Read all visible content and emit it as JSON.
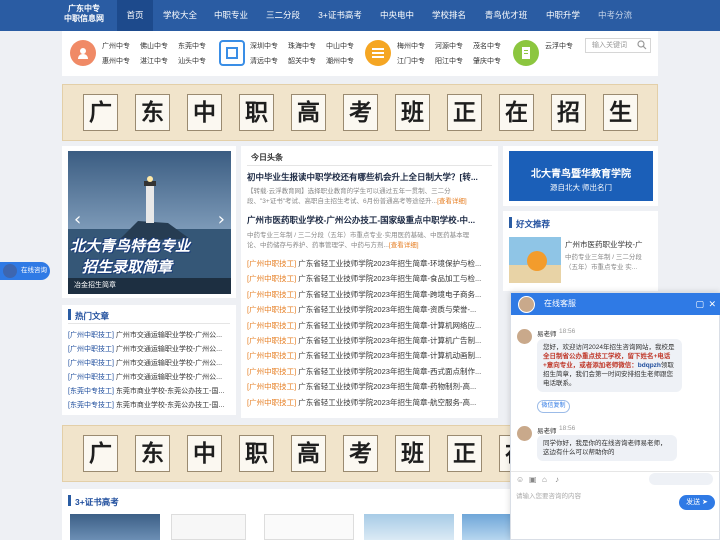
{
  "nav": {
    "logo_line1": "广东中专",
    "logo_line2": "中职信息网",
    "items": [
      "首页",
      "学校大全",
      "中职专业",
      "三二分段",
      "3+证书高考",
      "中央电中",
      "学校排名",
      "青鸟优才班",
      "中职升学",
      "中考分流"
    ]
  },
  "cats": {
    "group1": [
      "广州中专",
      "佛山中专",
      "东莞中专",
      "惠州中专",
      "湛江中专",
      "汕头中专"
    ],
    "group2": [
      "深圳中专",
      "珠海中专",
      "中山中专",
      "清远中专",
      "韶关中专",
      "潮州中专"
    ],
    "group3": [
      "梅州中专",
      "河源中专",
      "茂名中专",
      "江门中专",
      "阳江中专",
      "肇庆中专"
    ],
    "group4": [
      "云浮中专"
    ],
    "search_placeholder": "输入关键词"
  },
  "banner": {
    "chars": [
      "广",
      "东",
      "中",
      "职",
      "高",
      "考",
      "班",
      "正",
      "在",
      "招",
      "生"
    ]
  },
  "slider": {
    "caption": "冶金招生简章",
    "line1": "北大青鸟特色专业",
    "line2": "招生录取简章"
  },
  "headlines": {
    "title": "今日头条",
    "h1": "初中毕业生报读中职学校还有哪些机会升上全日制大学？[转...",
    "h1_desc1": "【转载·云浮教育网】选择职业教育的学生可以通过五年一贯制、三二分",
    "h1_desc2": "段、\"3+证书\"考试、高职自主招生考试、6月份普通高考等途径升...",
    "h1_more": "[查看详细]",
    "h2": "广州市医药职业学校-广州公办技工-国家级重点中职学校-中...",
    "h2_desc1": "中药专业三年制 / 三二分段（五年）市重点专业·实用医药基础、中医药基本理",
    "h2_desc2": "论、中药储存与养护、药事管理学、中药与方剂...",
    "h2_more": "[查看详细]",
    "tag": "[广州中职技工]",
    "list": [
      "广东省轻工业技师学院2023年招生简章-环境保护与检...",
      "广东省轻工业技师学院2023年招生简章-食品加工与检...",
      "广东省轻工业技师学院2023年招生简章-跨境电子商务...",
      "广东省轻工业技师学院2023年招生简章-资质与荣誉-...",
      "广东省轻工业技师学院2023年招生简章-计算机网络应...",
      "广东省轻工业技师学院2023年招生简章-计算机广告制...",
      "广东省轻工业技师学院2023年招生简章-计算机动画制...",
      "广东省轻工业技师学院2023年招生简章-西式面点制作...",
      "广东省轻工业技师学院2023年招生简章-药物制剂-高...",
      "广东省轻工业技师学院2023年招生简章-航空服务-高..."
    ]
  },
  "right": {
    "ad_line1": "北大青鸟暨华教育学院",
    "ad_line2": "源自北大  师出名门",
    "rec_title": "好文推荐",
    "rec_item": "广州市医药职业学校-广",
    "rec_desc1": "中药专业三年制 / 三二分段",
    "rec_desc2": "（五年）市重点专业 实..."
  },
  "hot": {
    "title": "热门文章",
    "items": [
      {
        "tag": "[广州中职技工]",
        "text": "广州市交通运输职业学校-广州公..."
      },
      {
        "tag": "[广州中职技工]",
        "text": "广州市交通运输职业学校-广州公..."
      },
      {
        "tag": "[广州中职技工]",
        "text": "广州市交通运输职业学校-广州公..."
      },
      {
        "tag": "[广州中职技工]",
        "text": "广州市交通运输职业学校-广州公..."
      },
      {
        "tag": "[东莞中专技工]",
        "text": "东莞市商业学校-东莞公办技工-国..."
      },
      {
        "tag": "[东莞中专技工]",
        "text": "东莞市商业学校-东莞公办技工-国..."
      }
    ]
  },
  "section3": {
    "title": "3+证书高考"
  },
  "chat": {
    "title": "在线客服",
    "agent": "易老师",
    "time1": "18:56",
    "msg1_a": "您好，欢迎访问2024年招生咨询网站，我校是",
    "msg1_b": "全日制省公办重点技工学校，留下姓名+电话+意向专业，或者添加老师微信：",
    "msg1_wechat": "bdqpzh",
    "msg1_c": "领取招生简章，我们会第一时间安排招生老师跟您电话联系。",
    "copy_label": "微信复制",
    "time2": "18:56",
    "msg2": "同学你好，我是你的在线咨询老师易老师，这边有什么可以帮助你的",
    "input_placeholder": "请输入您要咨询的内容",
    "send_label": "发送",
    "float_label": "在线咨询"
  },
  "colors": {
    "nav": "#2a5ca3",
    "accent": "#e67e22",
    "chat": "#2f7ae5"
  }
}
